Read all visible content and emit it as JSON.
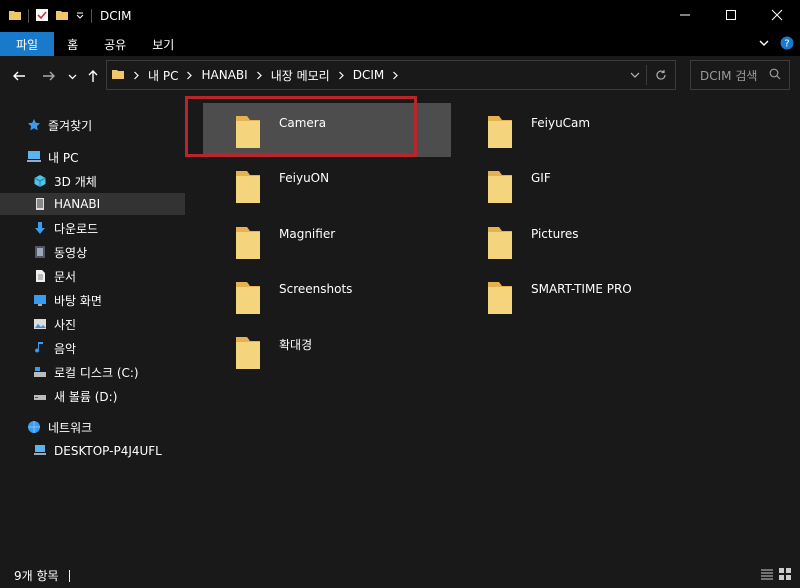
{
  "window": {
    "title": "DCIM"
  },
  "ribbon": {
    "tabs": [
      {
        "label": "파일",
        "active": true
      },
      {
        "label": "홈"
      },
      {
        "label": "공유"
      },
      {
        "label": "보기"
      }
    ]
  },
  "address": {
    "crumbs": [
      "내 PC",
      "HANABI",
      "내장 메모리",
      "DCIM"
    ]
  },
  "search": {
    "placeholder": "DCIM 검색"
  },
  "sidebar": {
    "items": [
      {
        "label": "즐겨찾기",
        "icon": "star-icon"
      },
      {
        "label": "내 PC",
        "icon": "pc-icon"
      },
      {
        "label": "3D 개체",
        "icon": "cube-icon"
      },
      {
        "label": "HANABI",
        "icon": "phone-icon",
        "selected": true
      },
      {
        "label": "다운로드",
        "icon": "download-icon"
      },
      {
        "label": "동영상",
        "icon": "video-icon"
      },
      {
        "label": "문서",
        "icon": "document-icon"
      },
      {
        "label": "바탕 화면",
        "icon": "desktop-icon"
      },
      {
        "label": "사진",
        "icon": "picture-icon"
      },
      {
        "label": "음악",
        "icon": "music-icon"
      },
      {
        "label": "로컬 디스크 (C:)",
        "icon": "drive-c-icon"
      },
      {
        "label": "새 볼륨 (D:)",
        "icon": "drive-d-icon"
      },
      {
        "label": "네트워크",
        "icon": "network-icon"
      },
      {
        "label": "DESKTOP-P4J4UFL",
        "icon": "computer-icon"
      }
    ]
  },
  "folders": [
    {
      "name": "Camera",
      "selected": true
    },
    {
      "name": "FeiyuCam"
    },
    {
      "name": "FeiyuON"
    },
    {
      "name": "GIF"
    },
    {
      "name": "Magnifier"
    },
    {
      "name": "Pictures"
    },
    {
      "name": "Screenshots"
    },
    {
      "name": "SMART-TIME PRO"
    },
    {
      "name": "확대경"
    }
  ],
  "status": {
    "count": "9개 항목"
  },
  "colors": {
    "accent": "#1979ca",
    "highlight_box": "#b8262b",
    "folder": "#f0c66a"
  }
}
